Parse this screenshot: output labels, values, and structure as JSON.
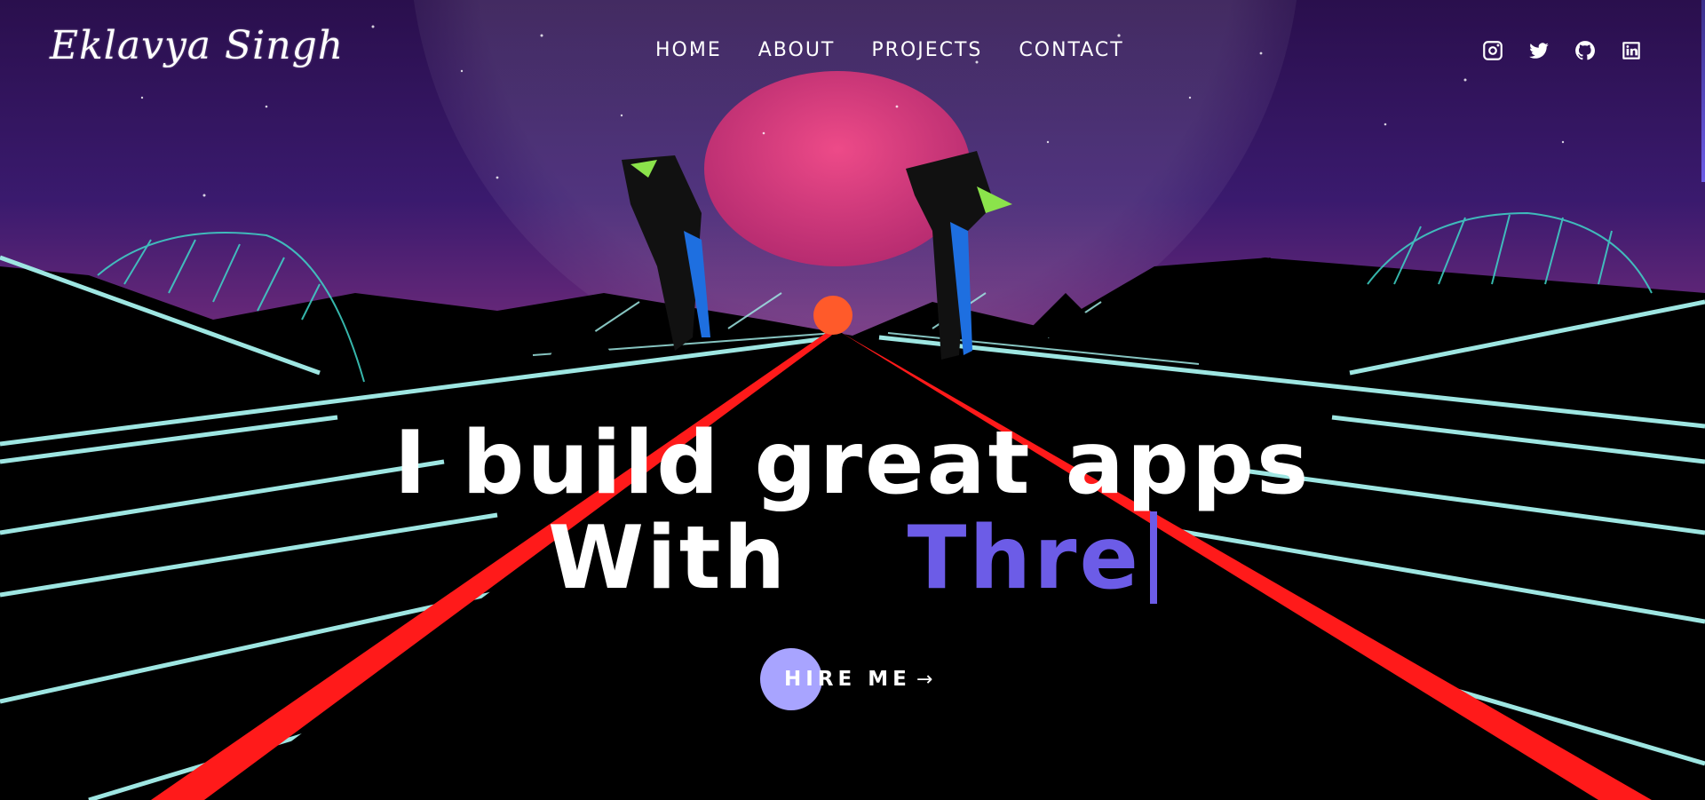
{
  "header": {
    "logo": "Eklavya Singh",
    "nav": [
      "HOME",
      "ABOUT",
      "PROJECTS",
      "CONTACT"
    ],
    "social": [
      {
        "name": "instagram-icon"
      },
      {
        "name": "twitter-icon"
      },
      {
        "name": "github-icon"
      },
      {
        "name": "linkedin-icon"
      }
    ]
  },
  "hero": {
    "line1": "I build great apps",
    "line2_prefix": "With",
    "typed_text": "Thre",
    "cta_label": "HIRE ME",
    "cta_arrow": "→"
  },
  "colors": {
    "accent": "#6c5ce7",
    "cta_circle": "#a8a4ff",
    "road_lines": "#ff1a1a",
    "grid": "#9ee6e2"
  }
}
